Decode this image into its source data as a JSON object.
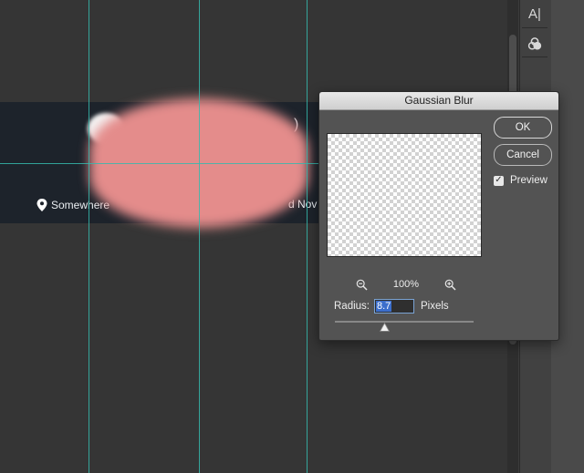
{
  "canvas": {
    "location_text": "Somewhere",
    "trailing_text": "d Nov",
    "paren_text": ")",
    "blob_color": "#e48c8b",
    "banner_color": "#1d232b",
    "guide_color": "#35b8ad"
  },
  "tools_panel": {
    "items": [
      {
        "icon": "character-icon",
        "label": "A|"
      },
      {
        "icon": "paragraph-styles-icon",
        "label": ""
      }
    ]
  },
  "dialog": {
    "title": "Gaussian Blur",
    "ok_label": "OK",
    "cancel_label": "Cancel",
    "preview_label": "Preview",
    "preview_checked": true,
    "zoom_level": "100%",
    "radius_label": "Radius:",
    "radius_value": "8.7",
    "radius_unit": "Pixels",
    "radius_slider_fraction": 0.36
  }
}
